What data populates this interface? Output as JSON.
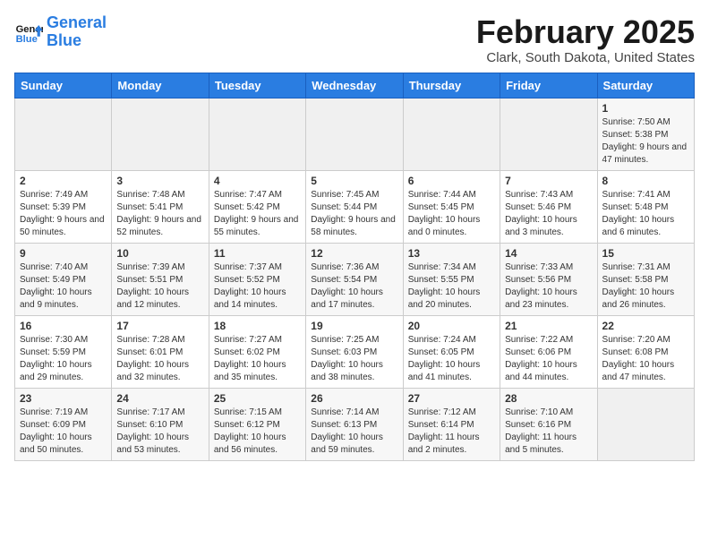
{
  "header": {
    "logo_line1": "General",
    "logo_line2": "Blue",
    "month": "February 2025",
    "location": "Clark, South Dakota, United States"
  },
  "weekdays": [
    "Sunday",
    "Monday",
    "Tuesday",
    "Wednesday",
    "Thursday",
    "Friday",
    "Saturday"
  ],
  "weeks": [
    [
      {
        "day": "",
        "info": ""
      },
      {
        "day": "",
        "info": ""
      },
      {
        "day": "",
        "info": ""
      },
      {
        "day": "",
        "info": ""
      },
      {
        "day": "",
        "info": ""
      },
      {
        "day": "",
        "info": ""
      },
      {
        "day": "1",
        "info": "Sunrise: 7:50 AM\nSunset: 5:38 PM\nDaylight: 9 hours and 47 minutes."
      }
    ],
    [
      {
        "day": "2",
        "info": "Sunrise: 7:49 AM\nSunset: 5:39 PM\nDaylight: 9 hours and 50 minutes."
      },
      {
        "day": "3",
        "info": "Sunrise: 7:48 AM\nSunset: 5:41 PM\nDaylight: 9 hours and 52 minutes."
      },
      {
        "day": "4",
        "info": "Sunrise: 7:47 AM\nSunset: 5:42 PM\nDaylight: 9 hours and 55 minutes."
      },
      {
        "day": "5",
        "info": "Sunrise: 7:45 AM\nSunset: 5:44 PM\nDaylight: 9 hours and 58 minutes."
      },
      {
        "day": "6",
        "info": "Sunrise: 7:44 AM\nSunset: 5:45 PM\nDaylight: 10 hours and 0 minutes."
      },
      {
        "day": "7",
        "info": "Sunrise: 7:43 AM\nSunset: 5:46 PM\nDaylight: 10 hours and 3 minutes."
      },
      {
        "day": "8",
        "info": "Sunrise: 7:41 AM\nSunset: 5:48 PM\nDaylight: 10 hours and 6 minutes."
      }
    ],
    [
      {
        "day": "9",
        "info": "Sunrise: 7:40 AM\nSunset: 5:49 PM\nDaylight: 10 hours and 9 minutes."
      },
      {
        "day": "10",
        "info": "Sunrise: 7:39 AM\nSunset: 5:51 PM\nDaylight: 10 hours and 12 minutes."
      },
      {
        "day": "11",
        "info": "Sunrise: 7:37 AM\nSunset: 5:52 PM\nDaylight: 10 hours and 14 minutes."
      },
      {
        "day": "12",
        "info": "Sunrise: 7:36 AM\nSunset: 5:54 PM\nDaylight: 10 hours and 17 minutes."
      },
      {
        "day": "13",
        "info": "Sunrise: 7:34 AM\nSunset: 5:55 PM\nDaylight: 10 hours and 20 minutes."
      },
      {
        "day": "14",
        "info": "Sunrise: 7:33 AM\nSunset: 5:56 PM\nDaylight: 10 hours and 23 minutes."
      },
      {
        "day": "15",
        "info": "Sunrise: 7:31 AM\nSunset: 5:58 PM\nDaylight: 10 hours and 26 minutes."
      }
    ],
    [
      {
        "day": "16",
        "info": "Sunrise: 7:30 AM\nSunset: 5:59 PM\nDaylight: 10 hours and 29 minutes."
      },
      {
        "day": "17",
        "info": "Sunrise: 7:28 AM\nSunset: 6:01 PM\nDaylight: 10 hours and 32 minutes."
      },
      {
        "day": "18",
        "info": "Sunrise: 7:27 AM\nSunset: 6:02 PM\nDaylight: 10 hours and 35 minutes."
      },
      {
        "day": "19",
        "info": "Sunrise: 7:25 AM\nSunset: 6:03 PM\nDaylight: 10 hours and 38 minutes."
      },
      {
        "day": "20",
        "info": "Sunrise: 7:24 AM\nSunset: 6:05 PM\nDaylight: 10 hours and 41 minutes."
      },
      {
        "day": "21",
        "info": "Sunrise: 7:22 AM\nSunset: 6:06 PM\nDaylight: 10 hours and 44 minutes."
      },
      {
        "day": "22",
        "info": "Sunrise: 7:20 AM\nSunset: 6:08 PM\nDaylight: 10 hours and 47 minutes."
      }
    ],
    [
      {
        "day": "23",
        "info": "Sunrise: 7:19 AM\nSunset: 6:09 PM\nDaylight: 10 hours and 50 minutes."
      },
      {
        "day": "24",
        "info": "Sunrise: 7:17 AM\nSunset: 6:10 PM\nDaylight: 10 hours and 53 minutes."
      },
      {
        "day": "25",
        "info": "Sunrise: 7:15 AM\nSunset: 6:12 PM\nDaylight: 10 hours and 56 minutes."
      },
      {
        "day": "26",
        "info": "Sunrise: 7:14 AM\nSunset: 6:13 PM\nDaylight: 10 hours and 59 minutes."
      },
      {
        "day": "27",
        "info": "Sunrise: 7:12 AM\nSunset: 6:14 PM\nDaylight: 11 hours and 2 minutes."
      },
      {
        "day": "28",
        "info": "Sunrise: 7:10 AM\nSunset: 6:16 PM\nDaylight: 11 hours and 5 minutes."
      },
      {
        "day": "",
        "info": ""
      }
    ]
  ]
}
